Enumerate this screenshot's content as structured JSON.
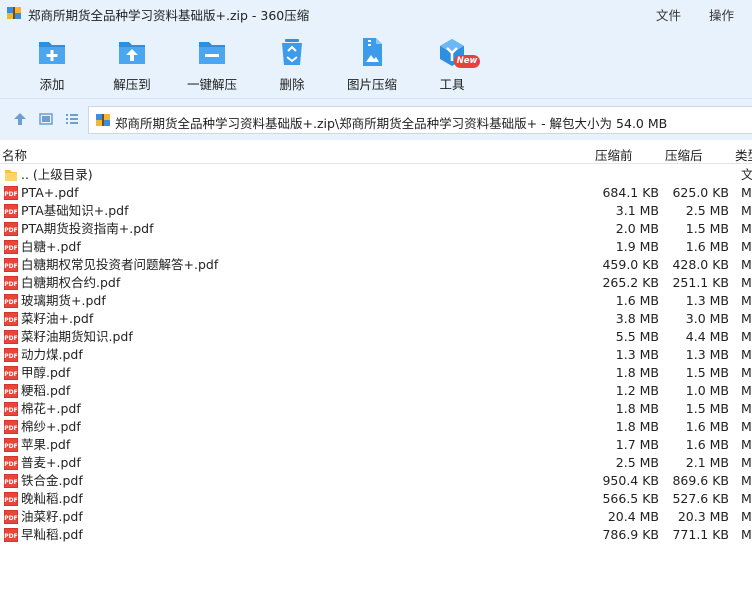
{
  "window": {
    "title": "郑商所期货全品种学习资料基础版+.zip - 360压缩",
    "menu": {
      "file": "文件",
      "operate": "操作"
    }
  },
  "toolbar": {
    "add": "添加",
    "extract_to": "解压到",
    "one_click_extract": "一键解压",
    "delete": "删除",
    "image_compress": "图片压缩",
    "tools": "工具",
    "new_badge": "New"
  },
  "navbar": {
    "path": "郑商所期货全品种学习资料基础版+.zip\\郑商所期货全品种学习资料基础版+ - 解包大小为 54.0 MB"
  },
  "columns": {
    "name": "名称",
    "size": "压缩前",
    "packed": "压缩后",
    "type": "类型"
  },
  "colors": {
    "accent": "#2d8fe0",
    "pdf": "#d9342b",
    "folder": "#f5c542",
    "chrome": "#e8f2fc"
  },
  "files": [
    {
      "name": ".. (上级目录)",
      "size": "",
      "packed": "",
      "type": "文",
      "icon": "folder-icon"
    },
    {
      "name": "PTA+.pdf",
      "size": "684.1 KB",
      "packed": "625.0 KB",
      "type": "M",
      "icon": "pdf-icon"
    },
    {
      "name": "PTA基础知识+.pdf",
      "size": "3.1 MB",
      "packed": "2.5 MB",
      "type": "M",
      "icon": "pdf-icon"
    },
    {
      "name": "PTA期货投资指南+.pdf",
      "size": "2.0 MB",
      "packed": "1.5 MB",
      "type": "M",
      "icon": "pdf-icon"
    },
    {
      "name": "白糖+.pdf",
      "size": "1.9 MB",
      "packed": "1.6 MB",
      "type": "M",
      "icon": "pdf-icon"
    },
    {
      "name": "白糖期权常见投资者问题解答+.pdf",
      "size": "459.0 KB",
      "packed": "428.0 KB",
      "type": "M",
      "icon": "pdf-icon"
    },
    {
      "name": "白糖期权合约.pdf",
      "size": "265.2 KB",
      "packed": "251.1 KB",
      "type": "M",
      "icon": "pdf-icon"
    },
    {
      "name": "玻璃期货+.pdf",
      "size": "1.6 MB",
      "packed": "1.3 MB",
      "type": "M",
      "icon": "pdf-icon"
    },
    {
      "name": "菜籽油+.pdf",
      "size": "3.8 MB",
      "packed": "3.0 MB",
      "type": "M",
      "icon": "pdf-icon"
    },
    {
      "name": "菜籽油期货知识.pdf",
      "size": "5.5 MB",
      "packed": "4.4 MB",
      "type": "M",
      "icon": "pdf-icon"
    },
    {
      "name": "动力煤.pdf",
      "size": "1.3 MB",
      "packed": "1.3 MB",
      "type": "M",
      "icon": "pdf-icon"
    },
    {
      "name": "甲醇.pdf",
      "size": "1.8 MB",
      "packed": "1.5 MB",
      "type": "M",
      "icon": "pdf-icon"
    },
    {
      "name": "粳稻.pdf",
      "size": "1.2 MB",
      "packed": "1.0 MB",
      "type": "M",
      "icon": "pdf-icon"
    },
    {
      "name": "棉花+.pdf",
      "size": "1.8 MB",
      "packed": "1.5 MB",
      "type": "M",
      "icon": "pdf-icon"
    },
    {
      "name": "棉纱+.pdf",
      "size": "1.8 MB",
      "packed": "1.6 MB",
      "type": "M",
      "icon": "pdf-icon"
    },
    {
      "name": "苹果.pdf",
      "size": "1.7 MB",
      "packed": "1.6 MB",
      "type": "M",
      "icon": "pdf-icon"
    },
    {
      "name": "普麦+.pdf",
      "size": "2.5 MB",
      "packed": "2.1 MB",
      "type": "M",
      "icon": "pdf-icon"
    },
    {
      "name": "铁合金.pdf",
      "size": "950.4 KB",
      "packed": "869.6 KB",
      "type": "M",
      "icon": "pdf-icon"
    },
    {
      "name": "晚籼稻.pdf",
      "size": "566.5 KB",
      "packed": "527.6 KB",
      "type": "M",
      "icon": "pdf-icon"
    },
    {
      "name": "油菜籽.pdf",
      "size": "20.4 MB",
      "packed": "20.3 MB",
      "type": "M",
      "icon": "pdf-icon"
    },
    {
      "name": "早籼稻.pdf",
      "size": "786.9 KB",
      "packed": "771.1 KB",
      "type": "M",
      "icon": "pdf-icon"
    }
  ]
}
